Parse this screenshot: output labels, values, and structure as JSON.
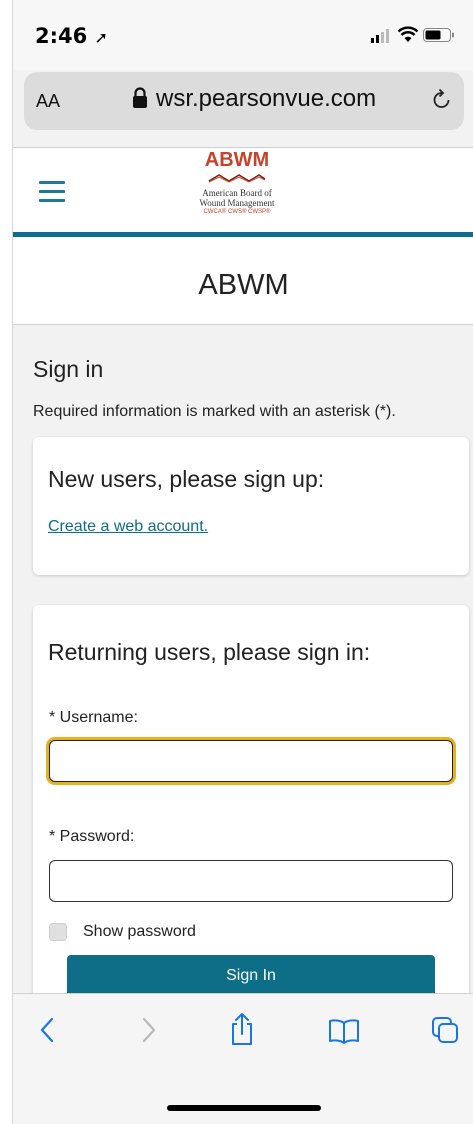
{
  "status_bar": {
    "time": "2:46"
  },
  "browser": {
    "text_size_label": "AA",
    "url": "wsr.pearsonvue.com"
  },
  "site": {
    "logo": {
      "abbr": "ABWM",
      "line1": "American Board of",
      "line2": "Wound Management",
      "credentials": "CWCA® CWS® CWSP®"
    },
    "page_title": "ABWM"
  },
  "signin": {
    "title": "Sign in",
    "required_note": "Required information is marked with an asterisk (*).",
    "new_users": {
      "heading": "New users, please sign up:",
      "link": "Create a web account."
    },
    "returning": {
      "heading": "Returning users, please sign in:",
      "username_label": "* Username:",
      "username_value": "",
      "password_label": "* Password:",
      "password_value": "",
      "show_password_label": "Show password",
      "submit_label": "Sign In"
    }
  },
  "colors": {
    "brand_teal": "#0e6e87",
    "logo_red": "#c5432b",
    "focus_ring": "#e8b120",
    "ios_blue": "#1a73e8"
  },
  "toolbar_icons": [
    "back-icon",
    "forward-icon",
    "share-icon",
    "bookmarks-icon",
    "tabs-icon"
  ]
}
